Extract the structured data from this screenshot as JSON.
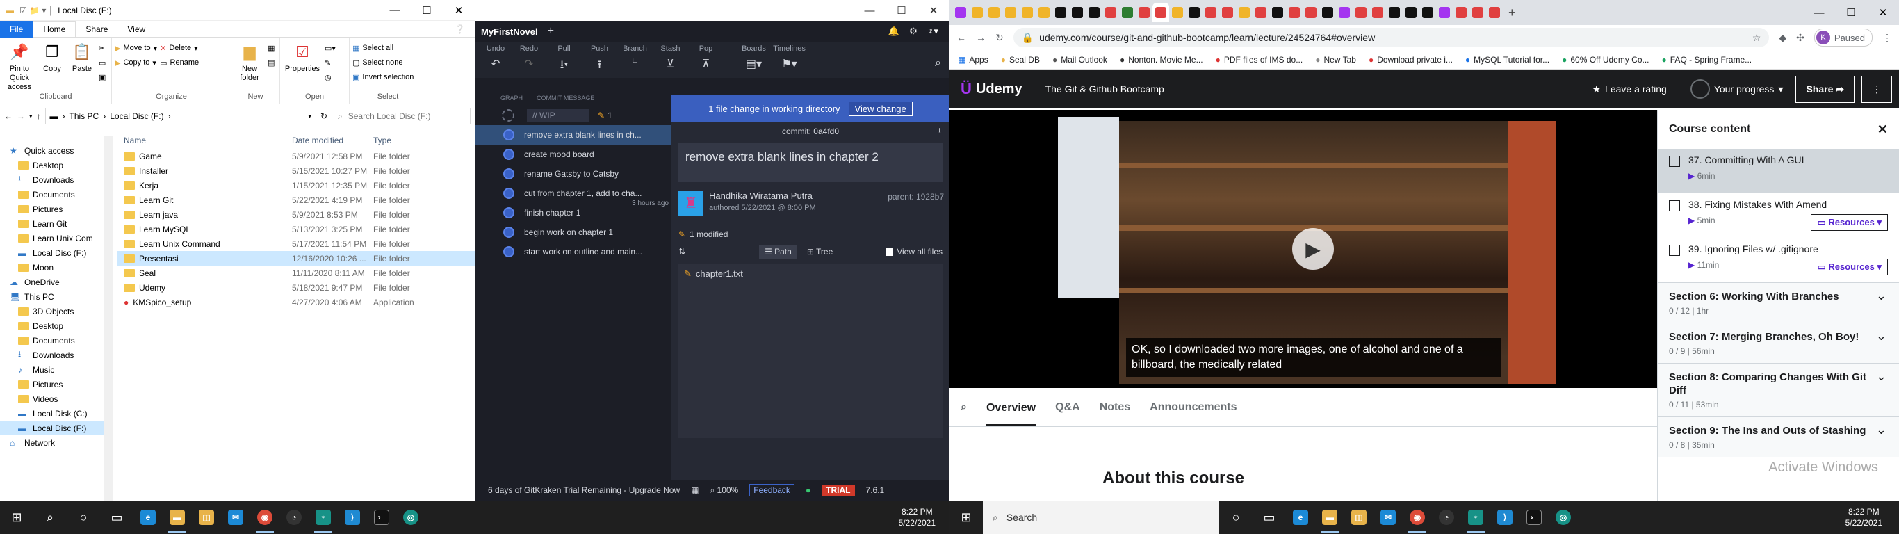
{
  "explorer": {
    "title": "Local Disc (F:)",
    "tabs": [
      "File",
      "Home",
      "Share",
      "View"
    ],
    "ribbon": {
      "clipboard": {
        "label": "Clipboard",
        "pin": "Pin to Quick access",
        "copy": "Copy",
        "paste": "Paste"
      },
      "organize": {
        "label": "Organize",
        "move_to": "Move to",
        "copy_to": "Copy to",
        "delete": "Delete",
        "rename": "Rename"
      },
      "new": {
        "label": "New",
        "new_folder": "New folder"
      },
      "open": {
        "label": "Open",
        "properties": "Properties"
      },
      "select": {
        "label": "Select",
        "select_all": "Select all",
        "select_none": "Select none",
        "invert": "Invert selection"
      }
    },
    "address": [
      "This PC",
      "Local Disc (F:)"
    ],
    "search_placeholder": "Search Local Disc (F:)",
    "nav": [
      {
        "label": "Quick access",
        "icon": "star-icon"
      },
      {
        "label": "Desktop",
        "icon": "folder-icon"
      },
      {
        "label": "Downloads",
        "icon": "download-icon"
      },
      {
        "label": "Documents",
        "icon": "folder-icon"
      },
      {
        "label": "Pictures",
        "icon": "folder-icon"
      },
      {
        "label": "Learn Git",
        "icon": "folder-icon"
      },
      {
        "label": "Learn Unix Com",
        "icon": "folder-icon"
      },
      {
        "label": "Local Disc (F:)",
        "icon": "drive-icon"
      },
      {
        "label": "Moon",
        "icon": "folder-icon"
      },
      {
        "label": "OneDrive",
        "icon": "cloud-icon"
      },
      {
        "label": "This PC",
        "icon": "pc-icon"
      },
      {
        "label": "3D Objects",
        "icon": "folder-icon"
      },
      {
        "label": "Desktop",
        "icon": "folder-icon"
      },
      {
        "label": "Documents",
        "icon": "folder-icon"
      },
      {
        "label": "Downloads",
        "icon": "download-icon"
      },
      {
        "label": "Music",
        "icon": "music-icon"
      },
      {
        "label": "Pictures",
        "icon": "folder-icon"
      },
      {
        "label": "Videos",
        "icon": "folder-icon"
      },
      {
        "label": "Local Disk (C:)",
        "icon": "drive-icon"
      },
      {
        "label": "Local Disc (F:)",
        "icon": "drive-icon"
      },
      {
        "label": "Network",
        "icon": "network-icon"
      }
    ],
    "columns": [
      "Name",
      "Date modified",
      "Type"
    ],
    "files": [
      [
        "Game",
        "5/9/2021 12:58 PM",
        "File folder"
      ],
      [
        "Installer",
        "5/15/2021 10:27 PM",
        "File folder"
      ],
      [
        "Kerja",
        "1/15/2021 12:35 PM",
        "File folder"
      ],
      [
        "Learn Git",
        "5/22/2021 4:19 PM",
        "File folder"
      ],
      [
        "Learn java",
        "5/9/2021 8:53 PM",
        "File folder"
      ],
      [
        "Learn MySQL",
        "5/13/2021 3:25 PM",
        "File folder"
      ],
      [
        "Learn Unix Command",
        "5/17/2021 11:54 PM",
        "File folder"
      ],
      [
        "Presentasi",
        "12/16/2020 10:26 ...",
        "File folder"
      ],
      [
        "Seal",
        "11/11/2020 8:11 AM",
        "File folder"
      ],
      [
        "Udemy",
        "5/18/2021 9:47 PM",
        "File folder"
      ],
      [
        "KMSpico_setup",
        "4/27/2020 4:06 AM",
        "Application"
      ]
    ]
  },
  "gitkraken": {
    "repo": "MyFirstNovel",
    "tools": [
      "Undo",
      "Redo",
      "Pull",
      "Push",
      "Branch",
      "Stash",
      "Pop"
    ],
    "tools2": [
      "Boards",
      "Timelines"
    ],
    "col_graph": "GRAPH",
    "col_msg": "COMMIT MESSAGE",
    "wip": "// WIP",
    "wip_count": "1",
    "commits": [
      "remove extra blank lines in ch...",
      "create mood board",
      "rename Gatsby to Catsby",
      "cut from chapter 1, add to cha...",
      "finish chapter 1",
      "begin work on chapter 1",
      "start work on outline and main..."
    ],
    "ago": "3 hours ago",
    "banner": "1 file change in working directory",
    "view_change": "View change",
    "commit_label": "commit: 0a4fd0",
    "message": "remove extra blank lines in chapter 2",
    "author": "Handhika Wiratama Putra",
    "authored": "authored  5/22/2021 @ 8:00 PM",
    "parent": "parent: 1928b7",
    "modified": "1 modified",
    "path_tab": "Path",
    "tree_tab": "Tree",
    "view_all": "View all files",
    "file": "chapter1.txt",
    "trial": "6 days of GitKraken Trial Remaining - Upgrade Now",
    "zoom": "100%",
    "feedback": "Feedback",
    "badge": "TRIAL",
    "version": "7.6.1"
  },
  "chrome": {
    "url": "udemy.com/course/git-and-github-bootcamp/learn/lecture/24524764#overview",
    "profile": "Paused",
    "bookmarks": [
      "Apps",
      "Seal DB",
      "Mail Outlook",
      "Nonton. Movie Me...",
      "PDF files of IMS do...",
      "New Tab",
      "Download private i...",
      "MySQL Tutorial for...",
      "60% Off Udemy Co...",
      "FAQ - Spring Frame..."
    ],
    "udemy": {
      "logo": "Udemy",
      "course": "The Git & Github Bootcamp",
      "rating": "Leave a rating",
      "progress": "Your progress",
      "share": "Share",
      "caption": "OK, so I downloaded two more images, one of alcohol and one of a billboard, the medically related",
      "tabs": [
        "Overview",
        "Q&A",
        "Notes",
        "Announcements"
      ],
      "about": "About this course",
      "sidebar_title": "Course content",
      "lectures": [
        {
          "title": "37. Committing With A GUI",
          "dur": "6min",
          "res": ""
        },
        {
          "title": "38. Fixing Mistakes With Amend",
          "dur": "5min",
          "res": "Resources"
        },
        {
          "title": "39. Ignoring Files w/ .gitignore",
          "dur": "11min",
          "res": "Resources"
        }
      ],
      "sections": [
        {
          "title": "Section 6: Working With Branches",
          "meta": "0 / 12 | 1hr"
        },
        {
          "title": "Section 7: Merging Branches, Oh Boy!",
          "meta": "0 / 9 | 56min"
        },
        {
          "title": "Section 8: Comparing Changes With Git Diff",
          "meta": "0 / 11 | 53min"
        },
        {
          "title": "Section 9: The Ins and Outs of Stashing",
          "meta": "0 / 8 | 35min"
        }
      ],
      "watermark": "Activate Windows"
    }
  },
  "taskbar_left": {
    "time": "8:22 PM",
    "date": "5/22/2021"
  },
  "taskbar_right": {
    "search": "Search",
    "time": "8:22 PM",
    "date": "5/22/2021"
  }
}
